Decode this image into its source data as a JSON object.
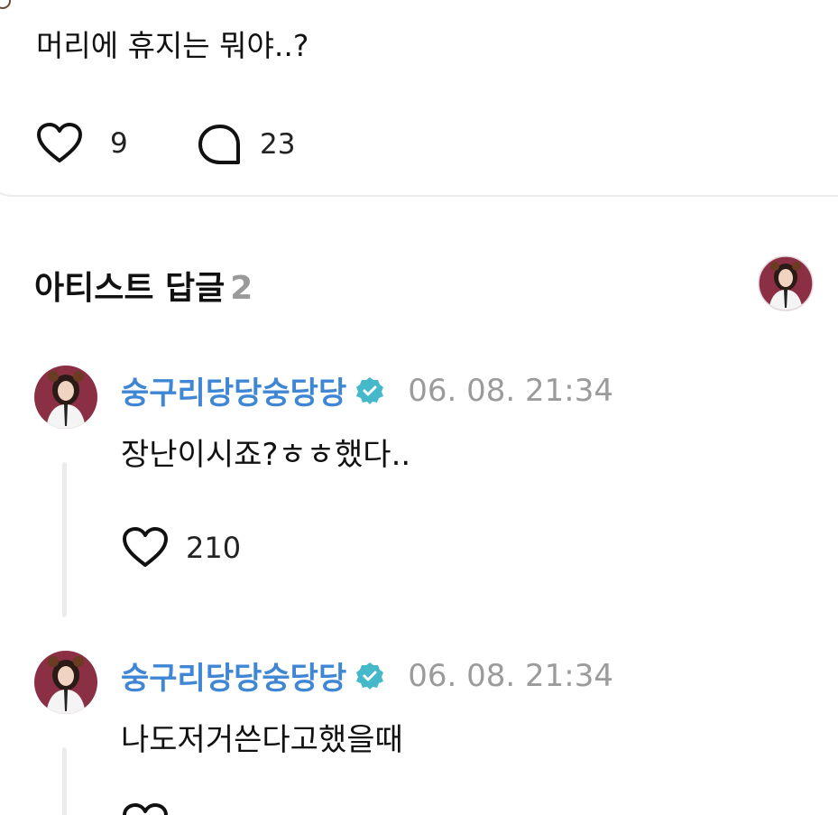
{
  "post": {
    "text": "머리에 휴지는 뭐야..?",
    "like_count": "9",
    "comment_count": "23"
  },
  "section": {
    "title": "아티스트 답글",
    "count": "2"
  },
  "replies": [
    {
      "author": "숭구리당당숭당당",
      "timestamp": "06. 08. 21:34",
      "text": "장난이시죠?ㅎㅎ했다..",
      "like_count": "210"
    },
    {
      "author": "숭구리당당숭당당",
      "timestamp": "06. 08. 21:34",
      "text": "나도저거쓴다고했을때"
    }
  ],
  "colors": {
    "author_name": "#3f86d4",
    "verified_badge": "#45b8c9",
    "timestamp": "#9b9b9b",
    "count_muted": "#9a9a9a",
    "avatar_bg": "#8a2f44"
  },
  "icons": [
    "heart-outline-icon",
    "comment-bubble-icon",
    "verified-badge-icon",
    "avatar-image"
  ]
}
